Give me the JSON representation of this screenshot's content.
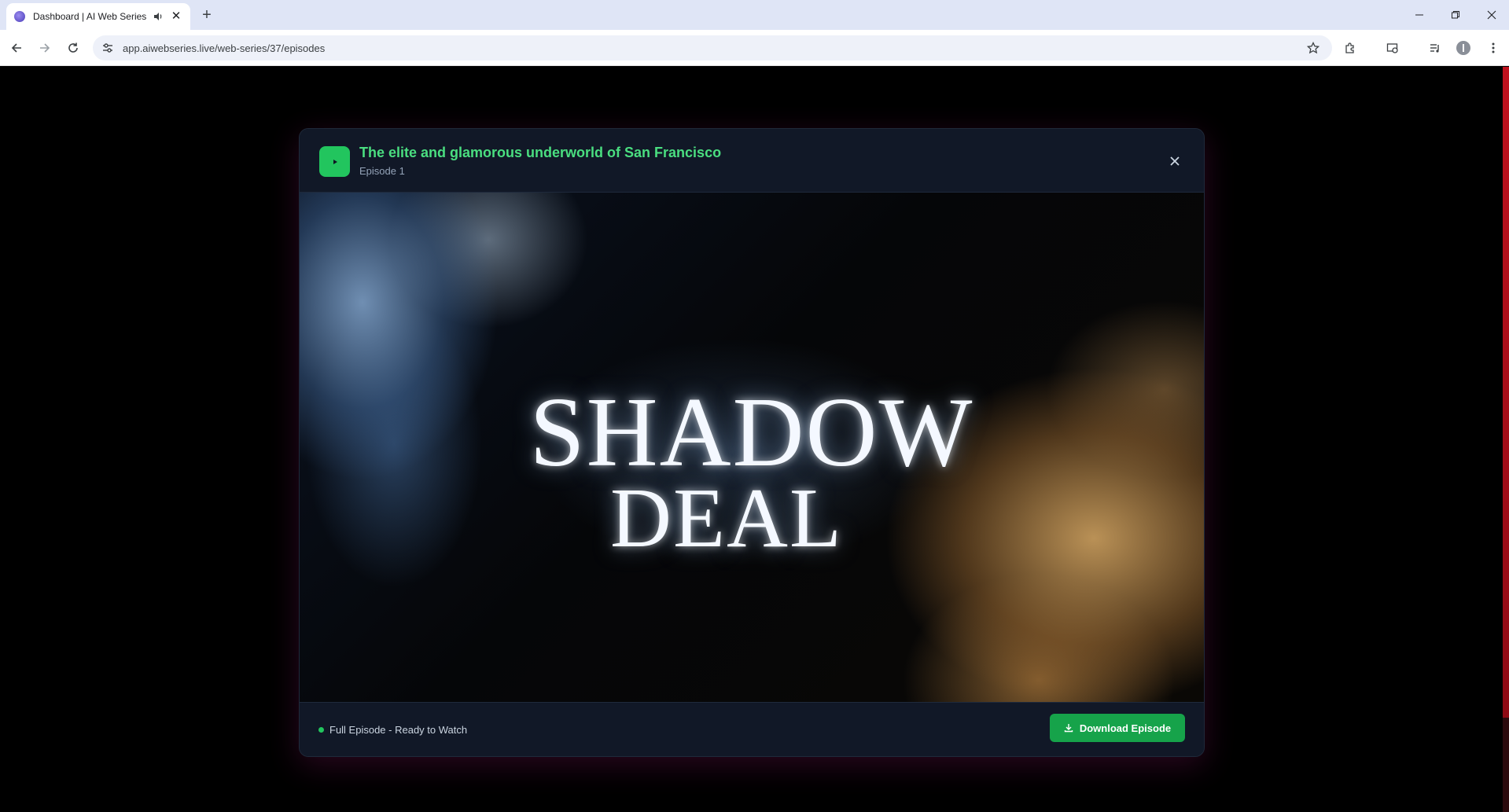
{
  "browser": {
    "tab_title": "Dashboard | AI Web Series",
    "url": "app.aiwebseries.live/web-series/37/episodes"
  },
  "modal": {
    "title": "The elite and glamorous underworld of San Francisco",
    "subtitle": "Episode 1",
    "video": {
      "title_line1": "SHADOW",
      "title_line2": "DEAL"
    },
    "status_text": "Full Episode - Ready to Watch",
    "download_label": "Download Episode"
  },
  "colors": {
    "accent_green": "#22c55e",
    "title_green": "#4ade80",
    "modal_bg": "#111827",
    "scrollbar": "#c0121e"
  },
  "icons": [
    "favicon-icon",
    "audio-icon",
    "close-icon",
    "plus-icon",
    "minimize-icon",
    "restore-icon",
    "back-icon",
    "forward-icon",
    "reload-icon",
    "tune-icon",
    "star-icon",
    "extensions-icon",
    "cast-icon",
    "media-icon",
    "profile-icon",
    "menu-icon",
    "play-icon",
    "download-icon"
  ]
}
